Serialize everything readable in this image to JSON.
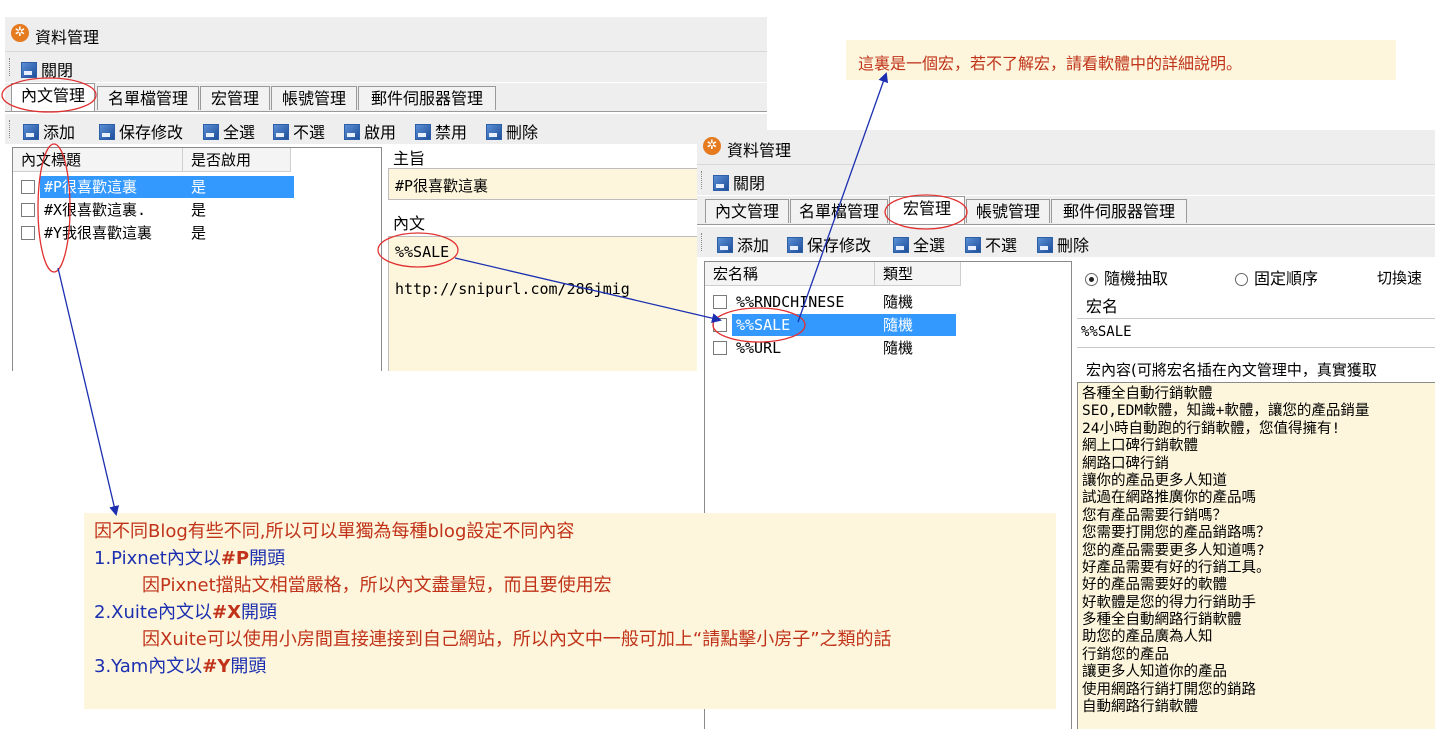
{
  "window_left": {
    "title": "資料管理",
    "close_label": "關閉",
    "tabs": [
      "內文管理",
      "名單檔管理",
      "宏管理",
      "帳號管理",
      "郵件伺服器管理"
    ],
    "toolbar": [
      "添加",
      "保存修改",
      "全選",
      "不選",
      "啟用",
      "禁用",
      "刪除"
    ],
    "list_headers": [
      "內文標題",
      "是否啟用"
    ],
    "rows": [
      {
        "title": "#P很喜歡這裏",
        "enabled": "是"
      },
      {
        "title": "#X很喜歡這裏.",
        "enabled": "是"
      },
      {
        "title": "#Y我很喜歡這裏",
        "enabled": "是"
      }
    ],
    "subject_label": "主旨",
    "subject_value": "#P很喜歡這裏",
    "content_label": "內文",
    "content_line1": "%%SALE",
    "content_line2": "http://snipurl.com/286jmig"
  },
  "window_right": {
    "title": "資料管理",
    "close_label": "關閉",
    "tabs": [
      "內文管理",
      "名單檔管理",
      "宏管理",
      "帳號管理",
      "郵件伺服器管理"
    ],
    "toolbar": [
      "添加",
      "保存修改",
      "全選",
      "不選",
      "刪除"
    ],
    "list_headers": [
      "宏名稱",
      "類型"
    ],
    "rows": [
      {
        "name": "%%RNDCHINESE",
        "type": "隨機"
      },
      {
        "name": "%%SALE",
        "type": "隨機"
      },
      {
        "name": "%%URL",
        "type": "隨機"
      }
    ],
    "radio_random": "隨機抽取",
    "radio_fixed": "固定順序",
    "switch_label": "切換速",
    "macro_name_label": "宏名",
    "macro_name_value": "%%SALE",
    "macro_content_label": "宏內容(可將宏名插在內文管理中，真實獲取",
    "macro_lines": [
      "各種全自動行銷軟體",
      "SEO,EDM軟體，知識+軟體，讓您的產品銷量",
      "24小時自動跑的行銷軟體，您值得擁有!",
      "網上口碑行銷軟體",
      "網路口碑行銷",
      "讓你的產品更多人知道",
      "試過在網路推廣你的產品嗎",
      "您有產品需要行銷嗎？",
      "您需要打開您的產品銷路嗎？",
      "您的產品需要更多人知道嗎?",
      "好產品需要有好的行銷工具。",
      "好的產品需要好的軟體",
      "好軟體是您的得力行銷助手",
      "多種全自動網路行銷軟體",
      "助您的產品廣為人知",
      "行銷您的產品",
      "讓更多人知道你的產品",
      "使用網路行銷打開您的銷路",
      "自動網路行銷軟體"
    ]
  },
  "callout_top": "這裏是一個宏，若不了解宏，請看軟體中的詳細說明。",
  "callout_bottom": {
    "line1": "因不同Blog有些不同,所以可以單獨為每種blog設定不同內容",
    "line2_a": "1.Pixnet內文以",
    "line2_b": "#P",
    "line2_c": "開頭",
    "line3": "因Pixnet擋貼文相當嚴格，所以內文盡量短，而且要使用宏",
    "line4_a": "2.Xuite內文以",
    "line4_b": "#X",
    "line4_c": "開頭",
    "line5": "因Xuite可以使用小房間直接連接到自己網站，所以內文中一般可加上“請點擊小房子”之類的話",
    "line6_a": "3.Yam內文以",
    "line6_b": "#Y",
    "line6_c": "開頭"
  },
  "colors": {
    "selection": "#3399ff",
    "annotation_arrow": "#1b2fb0",
    "annotation_circle": "#e03030",
    "note_background": "#fdf6dc",
    "note_red_text": "#c0331a",
    "note_blue_text": "#1b2fb0"
  }
}
